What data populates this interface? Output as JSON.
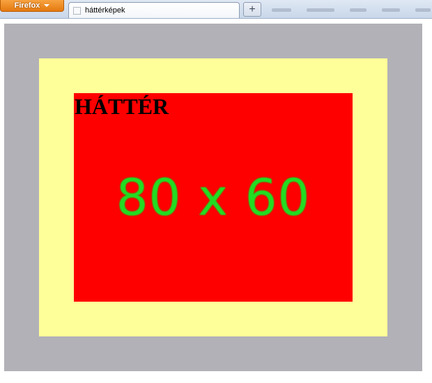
{
  "browser": {
    "firefox_button_label": "Firefox",
    "tab": {
      "title": "háttérképek"
    },
    "new_tab_label": "+"
  },
  "page": {
    "heading": "HÁTTÉR",
    "background_image_text": "80 x 60"
  },
  "colors": {
    "margin_area": "#b2b1b7",
    "padding_area": "#ffff99",
    "content_area": "#ff0000",
    "image_text": "#22dd22"
  }
}
